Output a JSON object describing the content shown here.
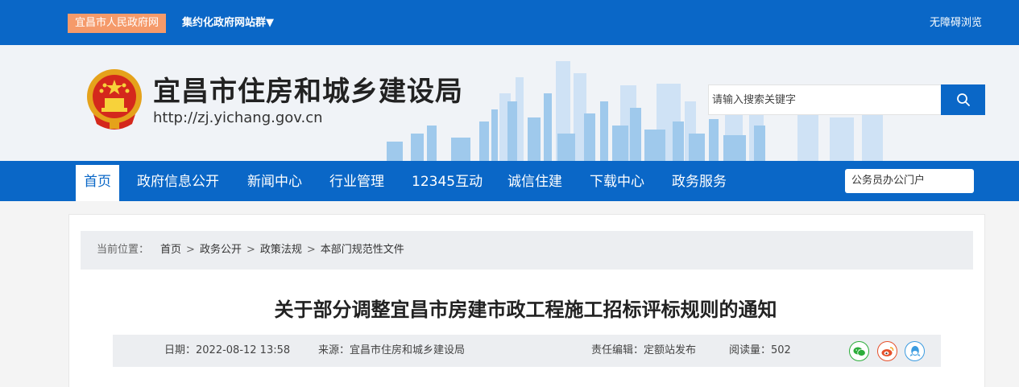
{
  "topbar": {
    "portal_link": "宜昌市人民政府网",
    "site_group": "集约化政府网站群▼",
    "accessible": "无障碍浏览"
  },
  "header": {
    "title": "宜昌市住房和城乡建设局",
    "url": "http://zj.yichang.gov.cn",
    "search_placeholder": "请输入搜索关键字"
  },
  "nav": {
    "items": [
      {
        "label": "首页",
        "active": true
      },
      {
        "label": "政府信息公开"
      },
      {
        "label": "新闻中心"
      },
      {
        "label": "行业管理"
      },
      {
        "label": "12345互动"
      },
      {
        "label": "诚信住建"
      },
      {
        "label": "下载中心"
      },
      {
        "label": "政务服务"
      }
    ],
    "staff_portal": "公务员办公门户"
  },
  "breadcrumb": {
    "label": "当前位置：",
    "items": [
      "首页",
      "政务公开",
      "政策法规",
      "本部门规范性文件"
    ],
    "separator": ">"
  },
  "article": {
    "title": "关于部分调整宜昌市房建市政工程施工招标评标规则的通知",
    "date": "日期：2022-08-12 13:58",
    "source": "来源：宜昌市住房和城乡建设局",
    "editor": "责任编辑：定额站发布",
    "views": "阅读量：502"
  },
  "share": {
    "wechat_color": "#2bad3a",
    "weibo_color": "#e6502b",
    "qq_color": "#3a9be0"
  },
  "colors": {
    "primary": "#0a67c7",
    "portal_badge": "#f59a6a"
  }
}
